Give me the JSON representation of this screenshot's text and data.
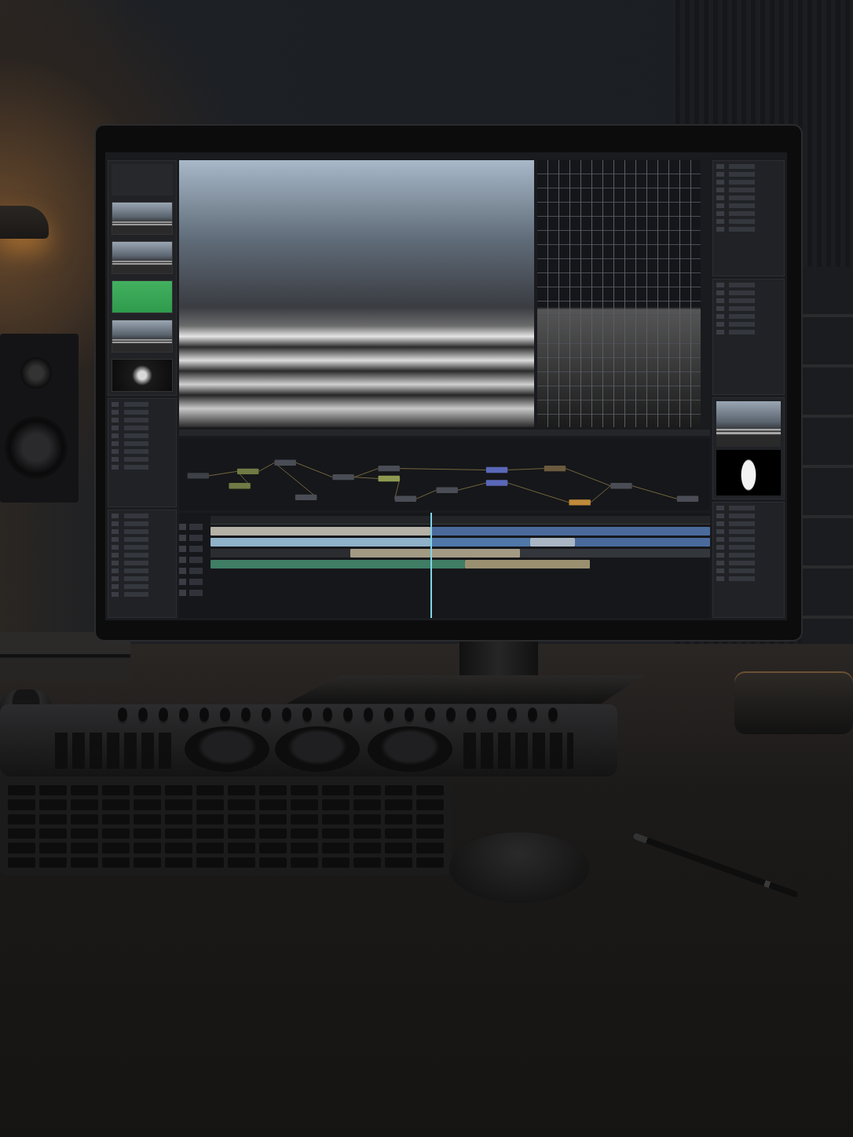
{
  "viewers": [
    {
      "kind": "photo"
    },
    {
      "kind": "wireframe"
    }
  ],
  "thumbnails": [
    {
      "kind": "street"
    },
    {
      "kind": "street"
    },
    {
      "kind": "green"
    },
    {
      "kind": "street"
    },
    {
      "kind": "dark"
    }
  ],
  "previews": [
    {
      "kind": "street"
    },
    {
      "kind": "matte"
    }
  ],
  "nodes": [
    {
      "color": "#3d4047"
    },
    {
      "color": "#6f7a44"
    },
    {
      "color": "#6f7a44"
    },
    {
      "color": "#4a4d55"
    },
    {
      "color": "#4a4d55"
    },
    {
      "color": "#4a4d55"
    },
    {
      "color": "#4a4d55"
    },
    {
      "color": "#8e9a52"
    },
    {
      "color": "#4a4d55"
    },
    {
      "color": "#4a4d55"
    },
    {
      "color": "#5a68b8"
    },
    {
      "color": "#5a68b8"
    },
    {
      "color": "#6b5a3e"
    },
    {
      "color": "#c08a3a"
    },
    {
      "color": "#4a4d55"
    },
    {
      "color": "#4a4d55"
    }
  ],
  "tracks": [
    {
      "clips": [
        {
          "color": "#b5b1a6"
        },
        {
          "color": "#4a6a9c"
        }
      ]
    },
    {
      "clips": [
        {
          "color": "#8fb2c9"
        },
        {
          "color": "#4f77a8"
        },
        {
          "color": "#aab6c4"
        },
        {
          "color": "#4a6a9c"
        }
      ]
    },
    {
      "clips": [
        {
          "color": "#2a2c30"
        },
        {
          "color": "#a39a84"
        },
        {
          "color": "#33363b"
        }
      ]
    },
    {
      "clips": [
        {
          "color": "#3f7d64"
        },
        {
          "color": "#9a9070"
        }
      ]
    }
  ]
}
